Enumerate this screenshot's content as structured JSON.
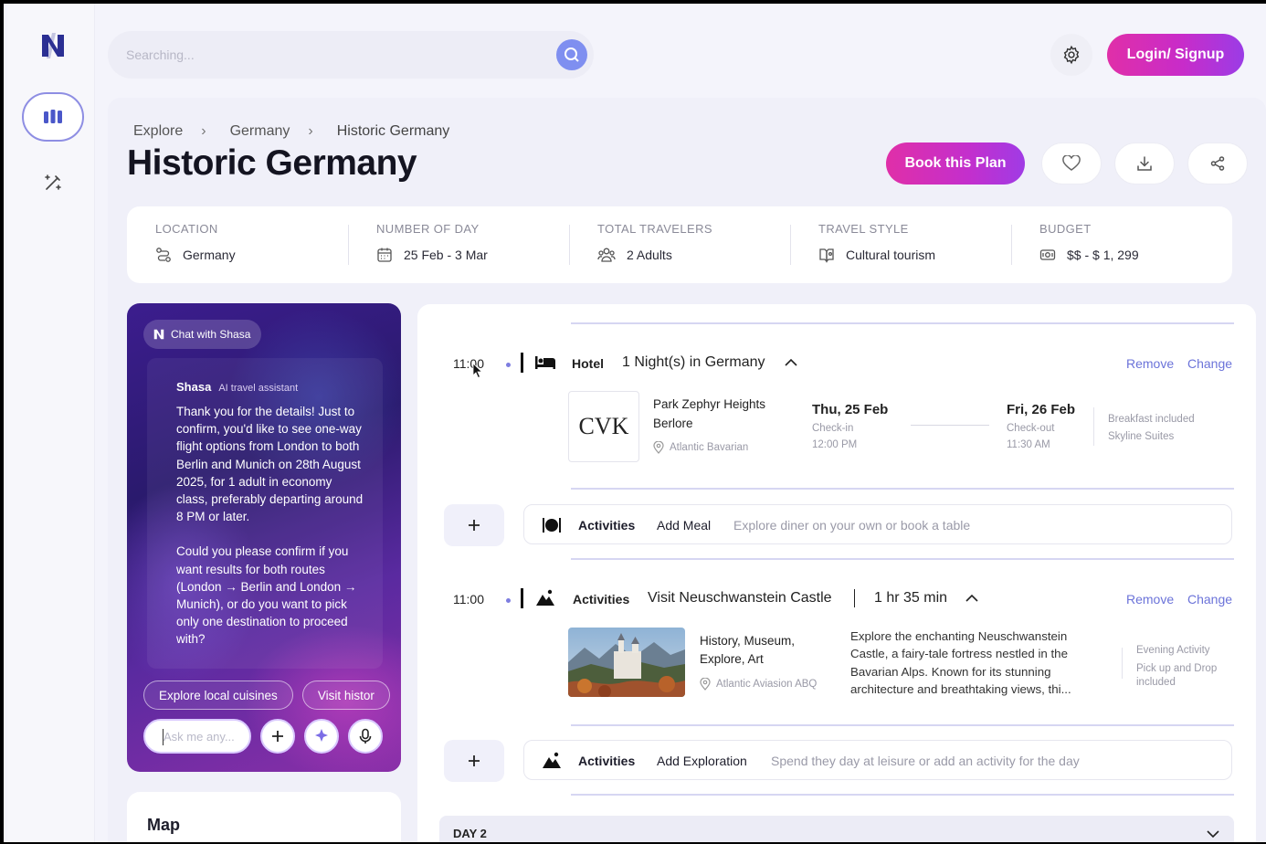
{
  "search": {
    "placeholder": "Searching..."
  },
  "header": {
    "login_label": "Login/ Signup"
  },
  "breadcrumb": [
    "Explore",
    "Germany",
    "Historic Germany"
  ],
  "page_title": "Historic Germany",
  "actions": {
    "book_label": "Book this Plan"
  },
  "info": [
    {
      "label": "LOCATION",
      "value": "Germany",
      "icon": "route-icon"
    },
    {
      "label": "NUMBER OF DAY",
      "value": "25 Feb - 3 Mar",
      "icon": "calendar-icon"
    },
    {
      "label": "TOTAL TRAVELERS",
      "value": "2 Adults",
      "icon": "people-icon"
    },
    {
      "label": "TRAVEL STYLE",
      "value": "Cultural tourism",
      "icon": "map-book-icon"
    },
    {
      "label": "BUDGET",
      "value": "$$ - $ 1, 299",
      "icon": "money-icon"
    }
  ],
  "chat": {
    "pill_label": "Chat with Shasa",
    "sender": "Shasa",
    "sender_role": "AI travel assistant",
    "message_1": "Thank you for the details! Just to confirm, you'd like to see one-way flight options from London to both Berlin and Munich on 28th August 2025, for 1 adult in economy class, preferably departing around 8 PM or later.",
    "message_2": "Could you please confirm if you want results for both routes (London → Berlin and London → Munich), or do you want to pick only one destination to proceed with?",
    "chips": [
      "Explore local cuisines",
      "Visit histor"
    ],
    "input_placeholder": "Ask me any..."
  },
  "map": {
    "title": "Map"
  },
  "itinerary": {
    "hotel": {
      "time": "11:00",
      "type": "Hotel",
      "desc": "1 Night(s) in Germany",
      "remove": "Remove",
      "change": "Change",
      "logo": "CVK",
      "name_line1": "Park Zephyr Heights",
      "name_line2": "Berlore",
      "location": "Atlantic Bavarian",
      "checkin_date": "Thu, 25 Feb",
      "checkin_label": "Check-in",
      "checkin_time": "12:00 PM",
      "checkout_date": "Fri, 26 Feb",
      "checkout_label": "Check-out",
      "checkout_time": "11:30 AM",
      "extra_1": "Breakfast included",
      "extra_2": "Skyline Suites"
    },
    "meal_bar": {
      "type": "Activities",
      "action": "Add Meal",
      "hint": "Explore diner on your own or book a table"
    },
    "activity": {
      "time": "11:00",
      "type": "Activities",
      "desc": "Visit Neuschwanstein Castle",
      "duration": "1 hr 35 min",
      "remove": "Remove",
      "change": "Change",
      "tags_line1": "History, Museum,",
      "tags_line2": "Explore, Art",
      "location": "Atlantic Aviasion ABQ",
      "description": "Explore the enchanting Neuschwanstein Castle, a fairy-tale fortress nestled in the Bavarian Alps. Known for its stunning architecture and breathtaking views, thi...",
      "extra_1": "Evening Activity",
      "extra_2": "Pick up and Drop included"
    },
    "explore_bar": {
      "type": "Activities",
      "action": "Add Exploration",
      "hint": "Spend they day at leisure or add an activity for the day"
    },
    "day2_label": "DAY 2"
  },
  "colors": {
    "accent": "#7f8ff0",
    "brand_pink": "#e02fa8",
    "brand_purple": "#9b3ce6",
    "link": "#6b73d9"
  }
}
